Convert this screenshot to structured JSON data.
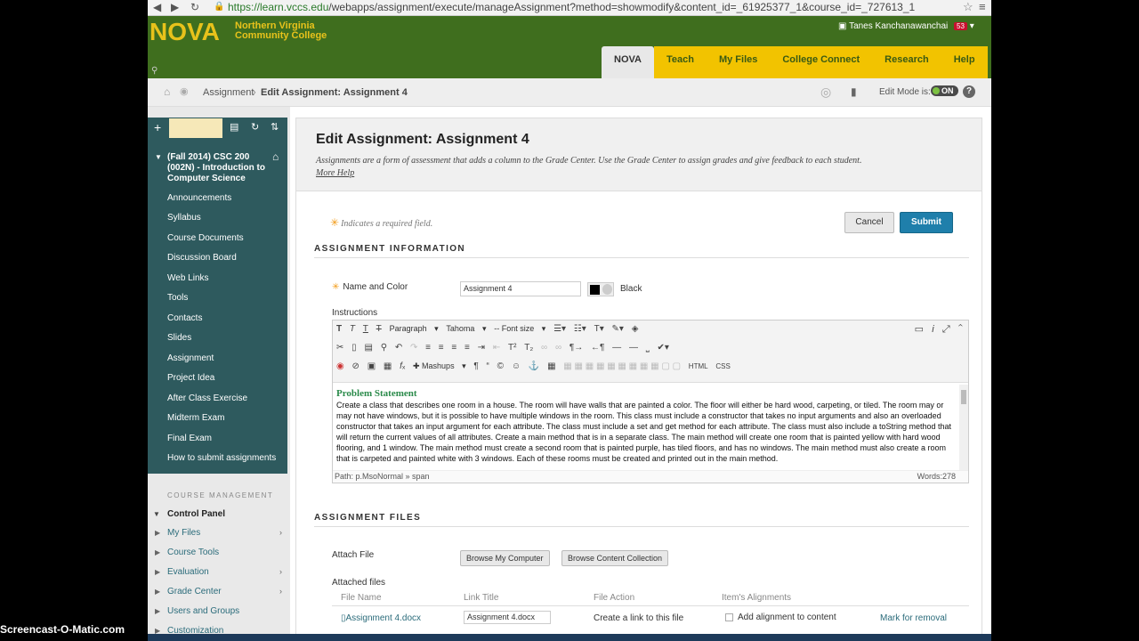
{
  "browser": {
    "url_host": "https://learn.vccs.edu",
    "url_path": "/webapps/assignment/execute/manageAssignment?method=showmodify&content_id=_61925377_1&course_id=_727613_1"
  },
  "header": {
    "logo": "NOVA",
    "logo_sub_1": "Northern Virginia",
    "logo_sub_2": "Community College",
    "user_name": "Tanes Kanchanawanchai",
    "notification_count": "53",
    "tabs": [
      "NOVA",
      "Teach",
      "My Files",
      "College Connect",
      "Research",
      "Help"
    ]
  },
  "breadcrumb": {
    "item1": "Assignment",
    "item2": "Edit Assignment: Assignment 4",
    "edit_mode_label": "Edit Mode is:",
    "edit_mode_value": "ON"
  },
  "sidebar": {
    "course_title": "(Fall 2014) CSC 200 (002N) - Introduction to Computer Science",
    "items": [
      "Announcements",
      "Syllabus",
      "Course Documents",
      "Discussion Board",
      "Web Links",
      "Tools",
      "Contacts",
      "Slides",
      "Assignment",
      "Project Idea",
      "After Class Exercise",
      "Midterm Exam",
      "Final Exam",
      "How to submit assignments"
    ],
    "management_title": "COURSE MANAGEMENT",
    "control_panel": "Control Panel",
    "management_items": [
      "My Files",
      "Course Tools",
      "Evaluation",
      "Grade Center",
      "Users and Groups",
      "Customization"
    ]
  },
  "main": {
    "title": "Edit Assignment: Assignment 4",
    "description": "Assignments are a form of assessment that adds a column to the Grade Center. Use the Grade Center to assign grades and give feedback to each student.",
    "more_help": "More Help",
    "required_note": "Indicates a required field.",
    "cancel": "Cancel",
    "submit": "Submit",
    "section_info": "ASSIGNMENT INFORMATION",
    "name_label": "Name and Color",
    "name_value": "Assignment 4",
    "color_name": "Black",
    "instructions_label": "Instructions",
    "editor": {
      "paragraph": "Paragraph",
      "font": "Tahoma",
      "font_size": "-- Font size",
      "mashups": "Mashups",
      "html": "HTML",
      "css": "CSS",
      "heading": "Problem Statement",
      "body": "Create a class that describes one room in a house. The room will have walls that are painted a color. The floor will either be hard wood, carpeting, or tiled. The room may or may not have windows, but it is possible to have multiple windows in the room. This class must include a constructor that takes no input arguments and also an overloaded constructor that takes an input argument for each attribute. The class must include a set and get method for each attribute. The class must also include a toString method that will return the current values of all attributes. Create a main method that is in a separate class. The main method will create one room that is painted yellow with hard wood flooring, and 1 window. The main method must create a second room that is painted purple, has tiled floors, and has no windows. The main method must also create a room that is carpeted and painted white with 3 windows. Each of these rooms must be created and printed out in the main method.",
      "path": "Path: p.MsoNormal » span",
      "words": "Words:278"
    },
    "section_files": "ASSIGNMENT FILES",
    "attach_label": "Attach File",
    "browse_computer": "Browse My Computer",
    "browse_collection": "Browse Content Collection",
    "attached_label": "Attached files",
    "columns": [
      "File Name",
      "Link Title",
      "File Action",
      "Item's Alignments"
    ],
    "file_row": {
      "file_name": "Assignment 4.docx",
      "link_title": "Assignment 4.docx",
      "file_action": "Create a link to this file",
      "alignment": "Add alignment to content",
      "remove": "Mark for removal"
    }
  },
  "watermark": "Screencast-O-Matic.com"
}
